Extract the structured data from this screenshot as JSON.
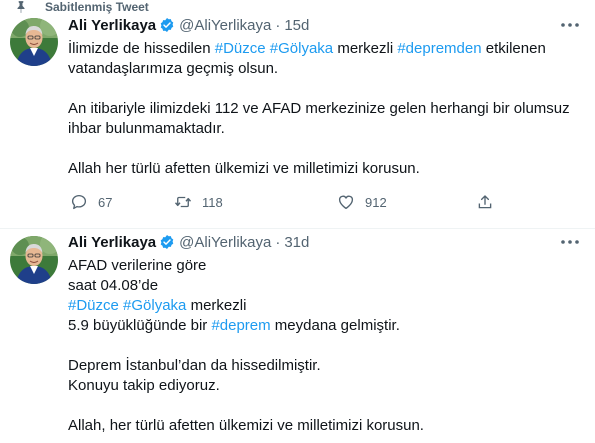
{
  "pinned_label": "Sabitlenmiş Tweet",
  "tweets": [
    {
      "name": "Ali Yerlikaya",
      "handle": "@AliYerlikaya",
      "separator": "·",
      "time": "15d",
      "paragraphs": [
        {
          "lines": [
            [
              {
                "text": "İlimizde de hissedilen ",
                "type": "text"
              },
              {
                "text": "#Düzce",
                "type": "hashtag"
              },
              {
                "text": " ",
                "type": "text"
              },
              {
                "text": "#Gölyaka",
                "type": "hashtag"
              },
              {
                "text": " merkezli ",
                "type": "text"
              },
              {
                "text": "#depremden",
                "type": "hashtag"
              },
              {
                "text": " etkilenen",
                "type": "text"
              }
            ],
            [
              {
                "text": "vatandaşlarımıza geçmiş olsun.",
                "type": "text"
              }
            ]
          ]
        },
        {
          "lines": [
            [
              {
                "text": "An itibariyle ilimizdeki  112 ve AFAD merkezinize gelen herhangi bir olumsuz",
                "type": "text"
              }
            ],
            [
              {
                "text": "ihbar bulunmamaktadır.",
                "type": "text"
              }
            ]
          ]
        },
        {
          "lines": [
            [
              {
                "text": "Allah her türlü afetten ülkemizi ve milletimizi korusun.",
                "type": "text"
              }
            ]
          ]
        }
      ],
      "stats": {
        "replies": "67",
        "retweets": "118",
        "likes": "912"
      }
    },
    {
      "name": "Ali Yerlikaya",
      "handle": "@AliYerlikaya",
      "separator": "·",
      "time": "31d",
      "paragraphs": [
        {
          "lines": [
            [
              {
                "text": "AFAD verilerine göre",
                "type": "text"
              }
            ],
            [
              {
                "text": "saat 04.08’de",
                "type": "text"
              }
            ],
            [
              {
                "text": "#Düzce",
                "type": "hashtag"
              },
              {
                "text": " ",
                "type": "text"
              },
              {
                "text": "#Gölyaka",
                "type": "hashtag"
              },
              {
                "text": " merkezli",
                "type": "text"
              }
            ],
            [
              {
                "text": "5.9 büyüklüğünde bir ",
                "type": "text"
              },
              {
                "text": "#deprem",
                "type": "hashtag"
              },
              {
                "text": " meydana gelmiştir.",
                "type": "text"
              }
            ]
          ]
        },
        {
          "lines": [
            [
              {
                "text": "Deprem İstanbul’dan da hissedilmiştir.",
                "type": "text"
              }
            ],
            [
              {
                "text": "Konuyu takip ediyoruz.",
                "type": "text"
              }
            ]
          ]
        },
        {
          "lines": [
            [
              {
                "text": "Allah, her türlü afetten ülkemizi ve milletimizi korusun.",
                "type": "text"
              }
            ]
          ]
        }
      ]
    }
  ],
  "icons": {
    "pin": "pin-icon",
    "verified": "verified-badge-icon",
    "more": "more-options-icon",
    "reply": "reply-icon",
    "retweet": "retweet-icon",
    "like": "like-heart-icon",
    "share": "share-icon"
  },
  "colors": {
    "hashtag": "#1d9bf0",
    "secondary_text": "#536471",
    "primary_text": "#0f1419",
    "verified_badge": "#1d9bf0",
    "divider": "#eff3f4"
  }
}
